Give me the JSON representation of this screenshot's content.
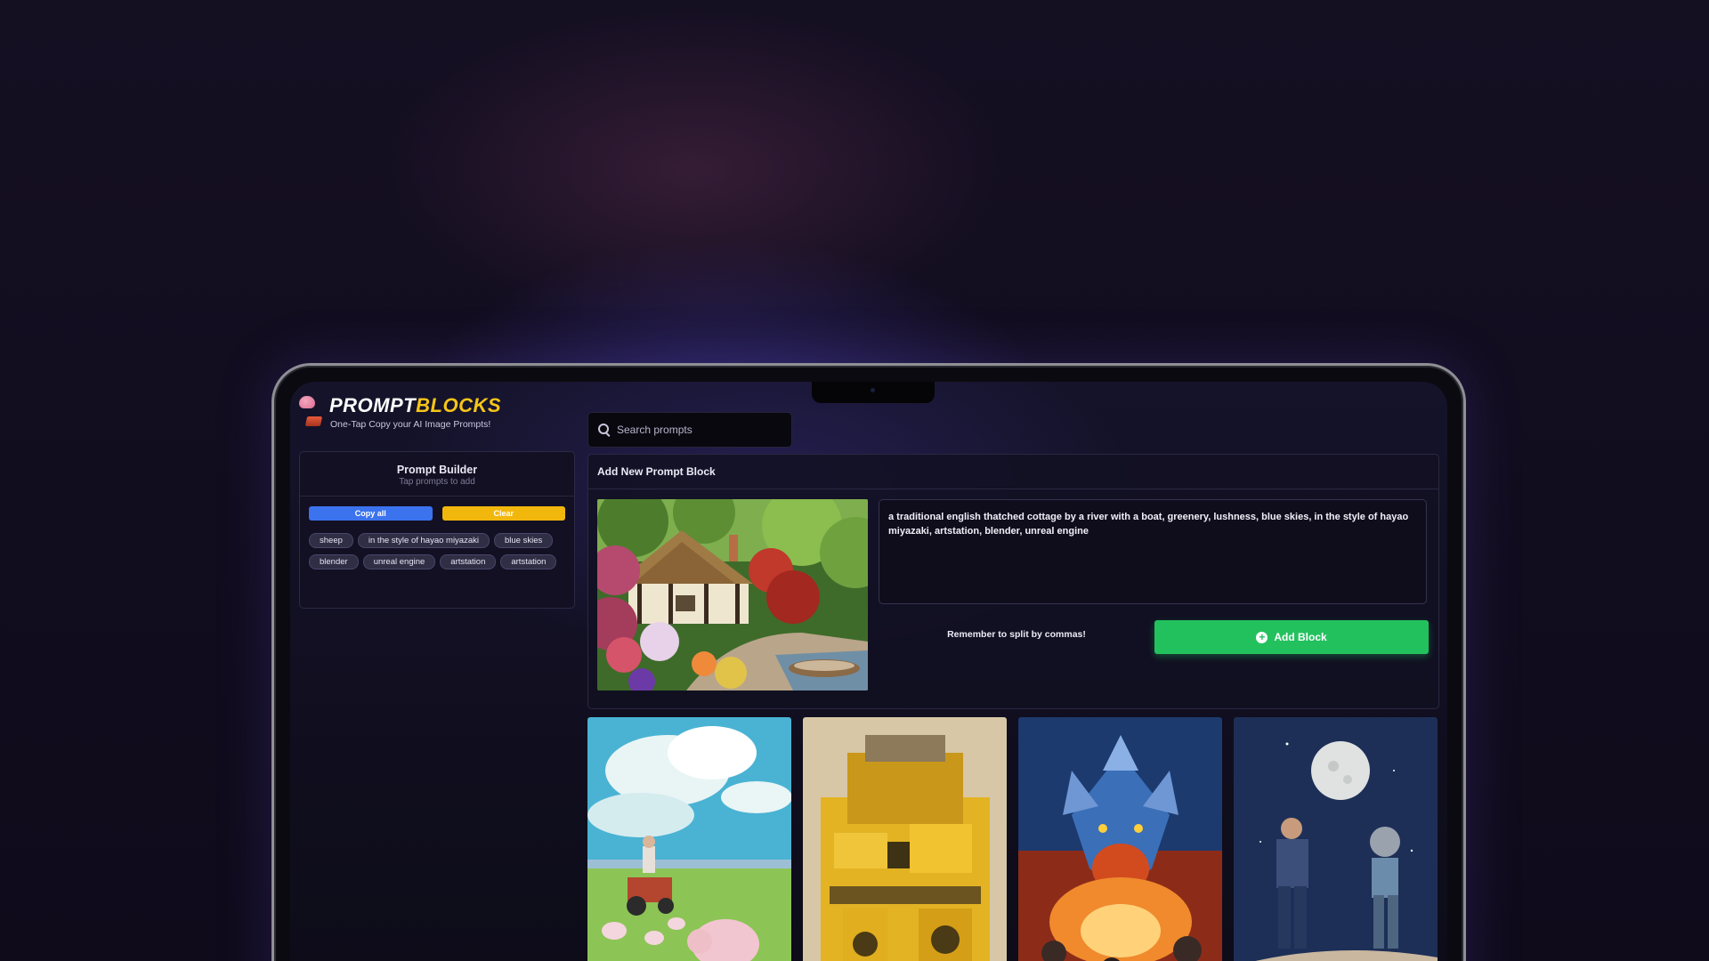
{
  "app": {
    "logo_part1": "PROMPT",
    "logo_part2": "BLOCKS",
    "tagline": "One-Tap Copy your AI Image Prompts!"
  },
  "search": {
    "placeholder": "Search prompts",
    "icon": "search-icon"
  },
  "builder": {
    "title": "Prompt Builder",
    "subtitle": "Tap prompts to add",
    "copy_label": "Copy all",
    "clear_label": "Clear",
    "chips": [
      "sheep",
      "in the style of hayao miyazaki",
      "blue skies",
      "blender",
      "unreal engine",
      "artstation",
      "artstation"
    ]
  },
  "add_block": {
    "header": "Add New Prompt Block",
    "prompt_text": "a traditional english thatched cottage by a river with a boat, greenery, lushness, blue skies, in the style of hayao miyazaki, artstation, blender, unreal engine",
    "hint": "Remember to split by commas!",
    "button_label": "Add Block",
    "button_icon": "plus-circle-icon"
  },
  "colors": {
    "copy_button": "#3b73ef",
    "clear_button": "#f2b70c",
    "add_button": "#22c15e",
    "logo_accent": "#f5c518"
  }
}
